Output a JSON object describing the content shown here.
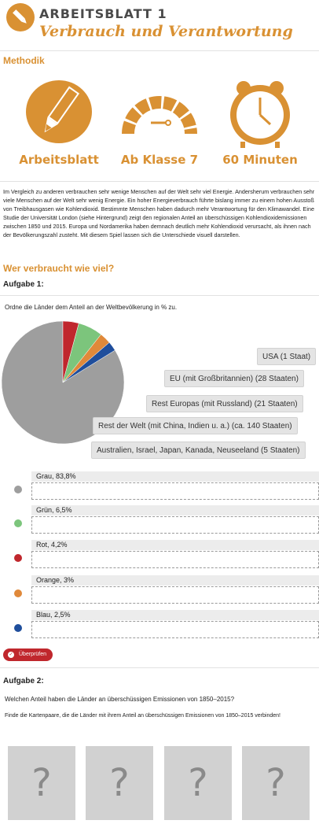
{
  "header": {
    "title": "ARBEITSBLATT 1",
    "subtitle": "Verbrauch und Verantwortung",
    "logo_icon": "pencil-icon"
  },
  "methodik": {
    "title": "Methodik",
    "items": [
      {
        "icon": "worksheet-pencil-icon",
        "label": "Arbeitsblatt"
      },
      {
        "icon": "gauge-icon",
        "label": "Ab Klasse 7"
      },
      {
        "icon": "alarm-clock-icon",
        "label": "60 Minuten"
      }
    ]
  },
  "intro": "Im Vergleich zu anderen verbrauchen sehr wenige Menschen auf der Welt sehr viel Energie. Andersherum verbrauchen sehr viele Menschen auf der Welt sehr wenig Energie. Ein hoher Energieverbrauch führte bislang immer zu einem hohen Ausstoß von Treibhausgasen wie Kohlendioxid. Bestimmte Menschen haben dadurch mehr Verantwortung für den Klimawandel. Eine Studie der Universität London (siehe Hintergrund) zeigt den regionalen Anteil an überschüssigen Kohlendioxidemissionen zwischen 1850 und 2015. Europa und Nordamerika haben demnach deutlich mehr Kohlendioxid verursacht, als ihnen nach der Bevölkerungszahl zusteht. Mit diesem Spiel lassen sich die Unterschiede visuell darstellen.",
  "section2": {
    "title": "Wer verbraucht wie viel?"
  },
  "task1": {
    "label": "Aufgabe 1:",
    "instruction": "Ordne die Länder dem Anteil an der Weltbevölkerung in % zu.",
    "chips": [
      "USA (1 Staat)",
      "EU (mit Großbritannien) (28 Staaten)",
      "Rest Europas (mit Russland) (21 Staaten)",
      "Rest der Welt (mit China, Indien u. a.) (ca. 140 Staaten)",
      "Australien, Israel, Japan, Kanada, Neuseeland (5 Staaten)"
    ],
    "slots": [
      {
        "label": "Grau, 83,8%",
        "color": "#9e9e9e"
      },
      {
        "label": "Grün, 6,5%",
        "color": "#7cc57c"
      },
      {
        "label": "Rot, 4,2%",
        "color": "#c0272d"
      },
      {
        "label": "Orange, 3%",
        "color": "#e0893a"
      },
      {
        "label": "Blau, 2,5%",
        "color": "#1f4e9c"
      }
    ],
    "check_button": "Überprüfen"
  },
  "chart_data": {
    "type": "pie",
    "slices": [
      {
        "value": 83.8,
        "color": "#9e9e9e"
      },
      {
        "value": 4.2,
        "color": "#c0272d"
      },
      {
        "value": 6.5,
        "color": "#7cc57c"
      },
      {
        "value": 3,
        "color": "#e0893a"
      },
      {
        "value": 2.5,
        "color": "#1f4e9c"
      }
    ]
  },
  "task2": {
    "label": "Aufgabe 2:",
    "question": "Welchen Anteil haben die Länder an überschüssigen Emissionen von 1850–2015?",
    "instruction": "Finde die Kartenpaare, die die Länder mit ihrem Anteil an überschüssigen Emissionen von 1850–2015 verbinden!",
    "cards": [
      "?",
      "?",
      "?",
      "?"
    ]
  }
}
